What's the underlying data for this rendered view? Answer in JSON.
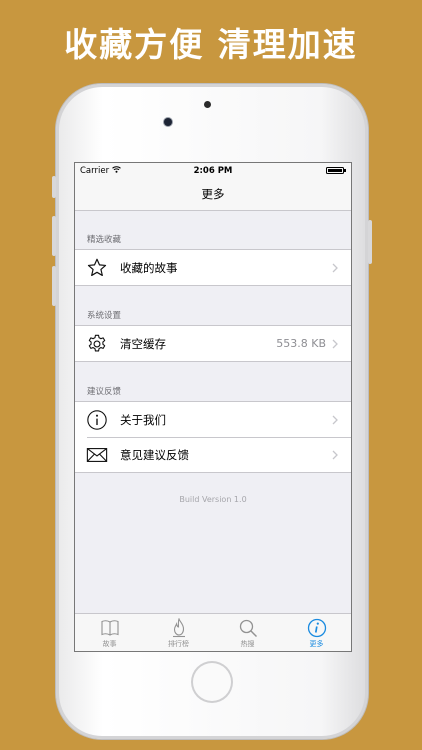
{
  "headline": "收藏方便 清理加速",
  "status_bar": {
    "carrier": "Carrier",
    "time": "2:06 PM"
  },
  "nav": {
    "title": "更多"
  },
  "sections": [
    {
      "header": "精选收藏",
      "items": [
        {
          "label": "收藏的故事",
          "icon": "star-icon",
          "value": ""
        }
      ]
    },
    {
      "header": "系统设置",
      "items": [
        {
          "label": "清空缓存",
          "icon": "gear-icon",
          "value": "553.8 KB"
        }
      ]
    },
    {
      "header": "建议反馈",
      "items": [
        {
          "label": "关于我们",
          "icon": "info-icon",
          "value": ""
        },
        {
          "label": "意见建议反馈",
          "icon": "envelope-icon",
          "value": ""
        }
      ]
    }
  ],
  "build_version": "Build Version 1.0",
  "tabs": [
    {
      "label": "故事",
      "icon": "book-icon",
      "active": false
    },
    {
      "label": "排行榜",
      "icon": "flame-icon",
      "active": false
    },
    {
      "label": "热搜",
      "icon": "search-icon",
      "active": false
    },
    {
      "label": "更多",
      "icon": "info-icon",
      "active": true
    }
  ],
  "colors": {
    "background": "#C8973F",
    "active_tab": "#1A8BE0",
    "inactive_tab": "#929292",
    "group_background": "#EFEFF4"
  }
}
